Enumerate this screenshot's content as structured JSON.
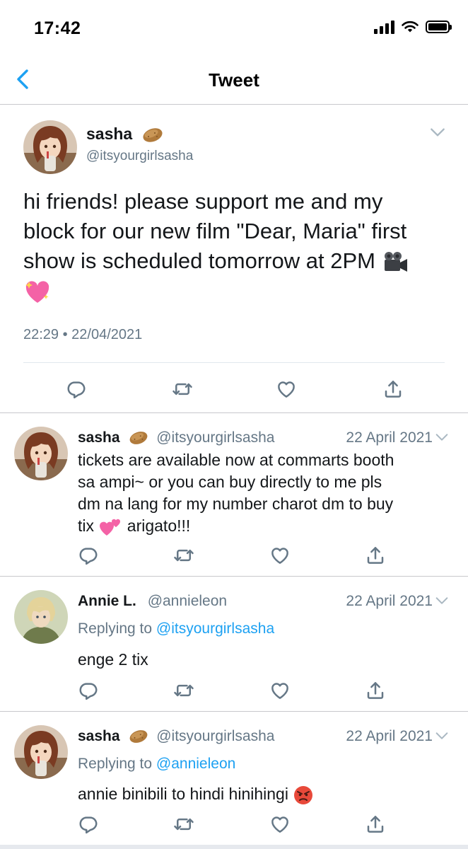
{
  "status_bar": {
    "time": "17:42"
  },
  "nav": {
    "title": "Tweet"
  },
  "main_tweet": {
    "name": "sasha",
    "handle": "@itsyourgirlsasha",
    "text_lines": [
      "hi friends! please support me and my",
      "block for our new film \"Dear, Maria\" first",
      "show is scheduled tomorrow at 2PM"
    ],
    "timestamp": "22:29 • 22/04/2021"
  },
  "replies": [
    {
      "name": "sasha",
      "handle": "@itsyourgirlsasha",
      "date": "22 April 2021",
      "lines": [
        "tickets are available now at commarts booth",
        "sa ampi~ or you can buy directly to me pls",
        "dm na lang for my number charot dm to buy"
      ],
      "last_line_before": "tix",
      "last_line_after": "arigato!!!"
    },
    {
      "name": "Annie L.",
      "handle": "@annieleon",
      "date": "22 April 2021",
      "replying_prefix": "Replying to",
      "replying_to": "@itsyourgirlsasha",
      "text": "enge 2 tix"
    },
    {
      "name": "sasha",
      "handle": "@itsyourgirlsasha",
      "date": "22 April 2021",
      "replying_prefix": "Replying to",
      "replying_to": "@annieleon",
      "text": "annie binibili to hindi hinihingi"
    }
  ],
  "icons": {
    "back": "chevron-left-icon",
    "reply": "comment-icon",
    "retweet": "retweet-icon",
    "like": "heart-icon",
    "share": "share-icon",
    "caret": "chevron-down-icon"
  },
  "colors": {
    "accent": "#1da1f2",
    "muted": "#657786",
    "text": "#14171a"
  }
}
